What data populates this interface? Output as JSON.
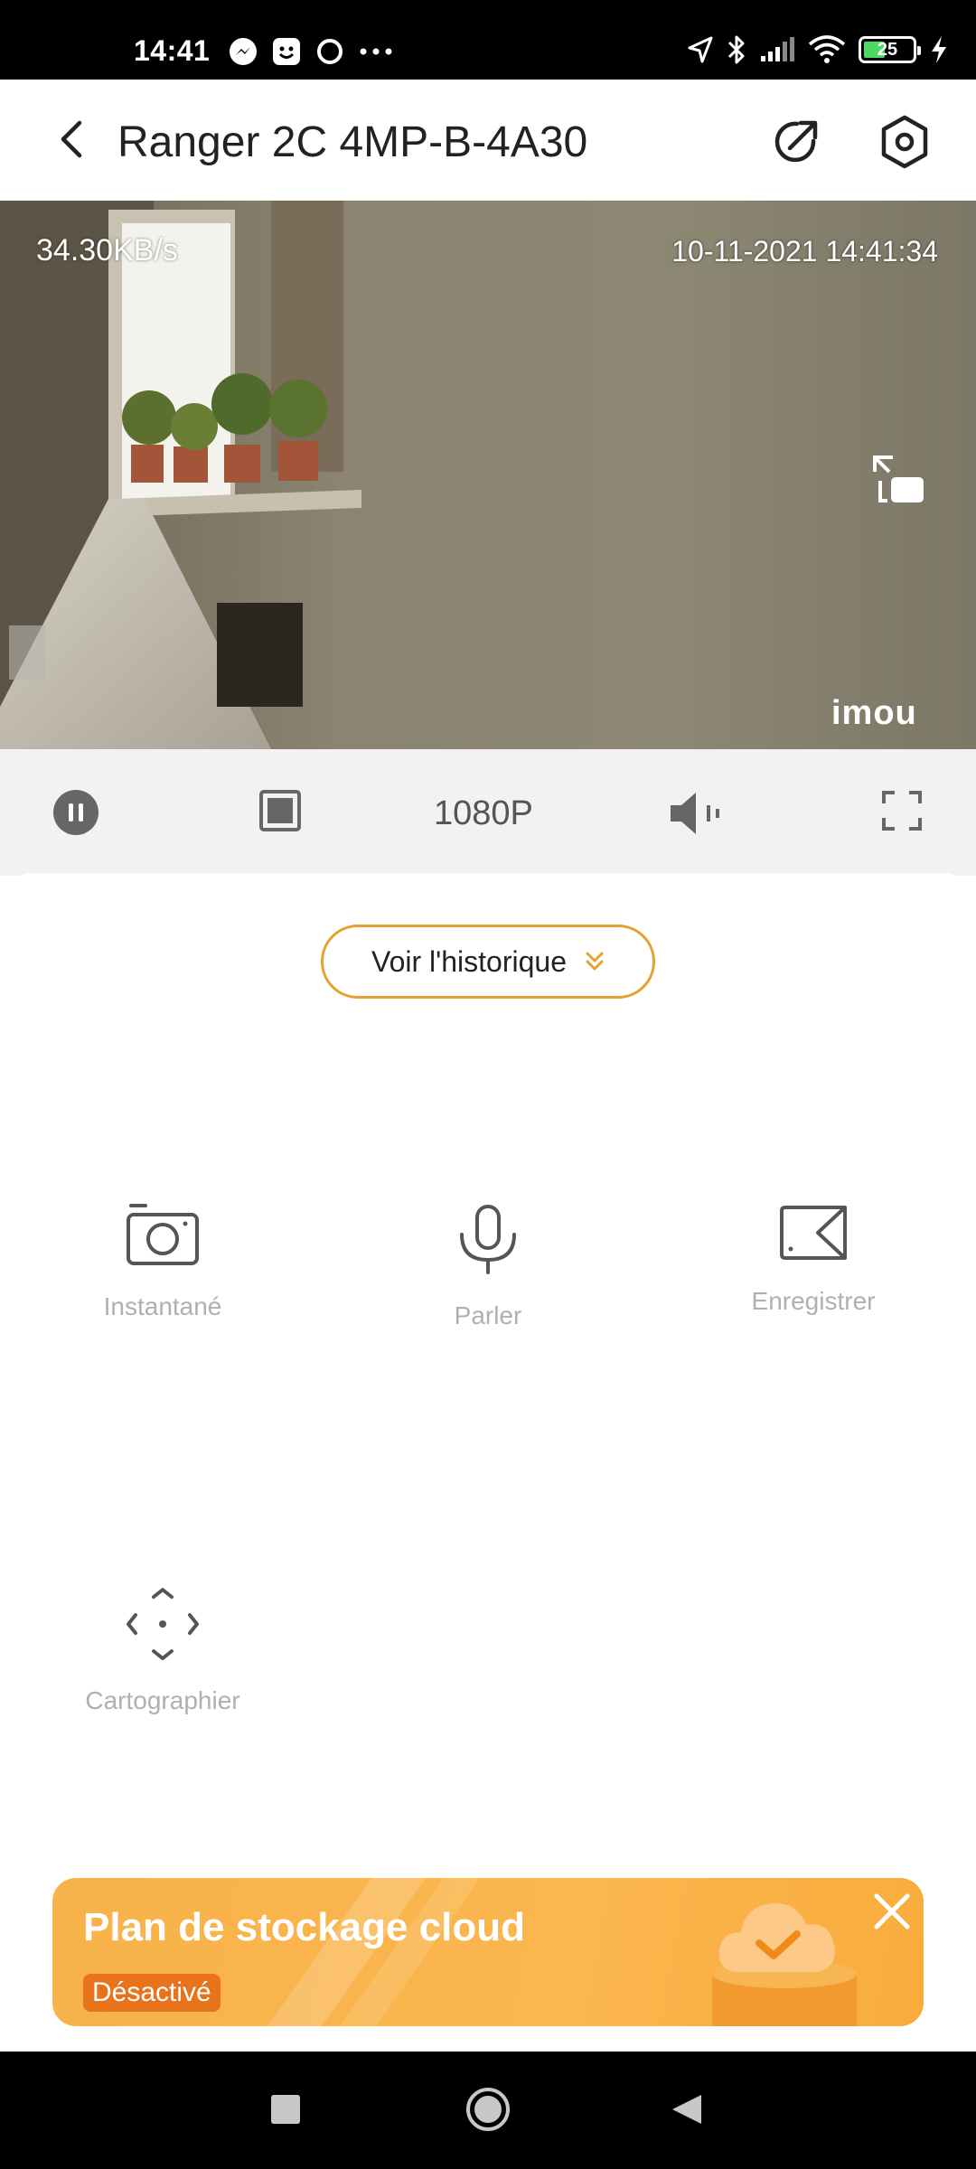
{
  "status_bar": {
    "time": "14:41",
    "battery_level": "25",
    "icons_left": [
      "messenger-icon",
      "app-face-icon",
      "circle-app-icon",
      "more-dots-icon"
    ],
    "icons_right": [
      "location-icon",
      "bluetooth-icon",
      "signal-icon",
      "wifi-icon",
      "battery-icon",
      "charging-icon"
    ]
  },
  "header": {
    "title": "Ranger 2C 4MP-B-4A30",
    "icons": [
      "back-arrow-icon",
      "share-icon",
      "settings-gear-icon"
    ]
  },
  "video": {
    "bitrate": "34.30KB/s",
    "timestamp": "10-11-2021 14:41:34",
    "watermark": "imou"
  },
  "controls": {
    "resolution": "1080P",
    "icons": [
      "pause-icon",
      "stop-icon",
      "volume-muted-icon",
      "fullscreen-icon"
    ]
  },
  "history_button": {
    "label": "Voir l'historique"
  },
  "features": [
    {
      "label": "Instantané",
      "icon": "camera-icon"
    },
    {
      "label": "Parler",
      "icon": "microphone-icon"
    },
    {
      "label": "Enregistrer",
      "icon": "video-record-icon"
    },
    {
      "label": "Cartographier",
      "icon": "ptz-directions-icon"
    }
  ],
  "cloud_banner": {
    "title": "Plan de stockage cloud",
    "status": "Désactivé"
  },
  "colors": {
    "accent": "#e6a02b",
    "banner": "#fbb64f",
    "badge": "#e8731a"
  }
}
